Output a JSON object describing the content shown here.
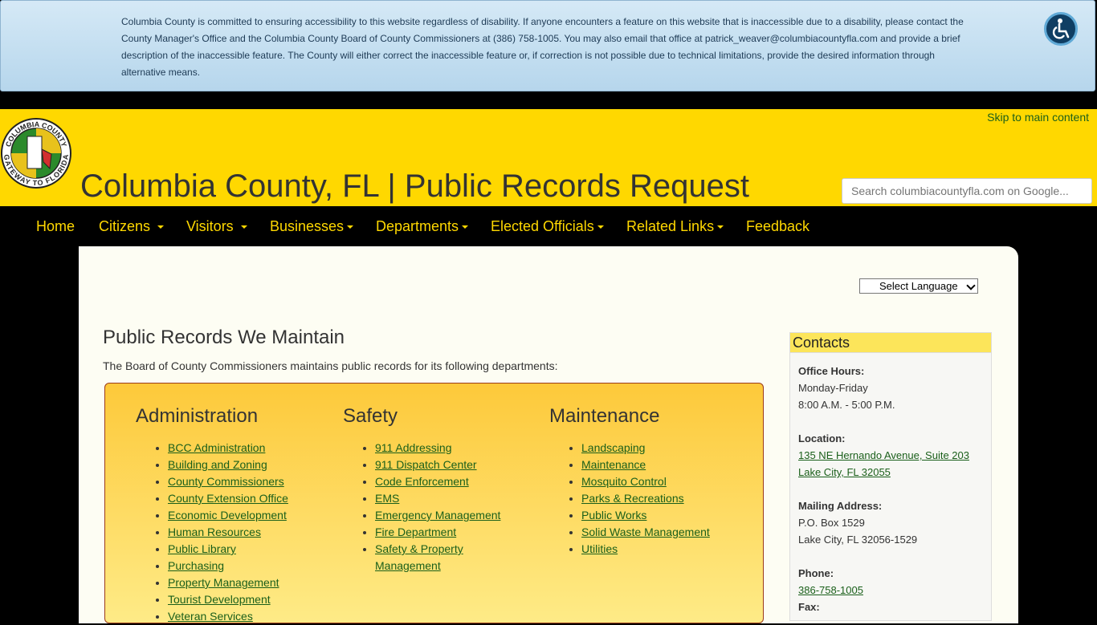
{
  "accessibility": {
    "notice": "Columbia County is committed to ensuring accessibility to this website regardless of disability. If anyone encounters a feature on this website that is inaccessible due to a disability, please contact the County Manager's Office and the Columbia County Board of County Commissioners at (386) 758-1005. You may also email that office at patrick_weaver@columbiacountyfla.com and provide a brief description of the inaccessible feature. The County will either correct the inaccessible feature or, if correction is not possible due to technical limitations, provide the desired information through alternative means."
  },
  "header": {
    "title": "Columbia County, FL | Public Records Request",
    "skip_link": "Skip to main content",
    "search_placeholder": "Search columbiacountyfla.com on Google...",
    "logo_top_text": "COLUMBIA COUNTY",
    "logo_bottom_text": "GATEWAY TO FLORIDA"
  },
  "nav": {
    "home": "Home",
    "citizens": "Citizens",
    "visitors": "Visitors",
    "businesses": "Businesses",
    "departments": "Departments",
    "elected": "Elected Officials",
    "related": "Related Links",
    "feedback": "Feedback"
  },
  "language": {
    "label": "Select Language"
  },
  "main": {
    "heading": "Public Records We Maintain",
    "intro": "The Board of County Commissioners maintains public records for its following departments:",
    "columns": [
      {
        "title": "Administration",
        "items": [
          "BCC Administration",
          "Building and Zoning",
          "County Commissioners",
          "County Extension Office",
          "Economic Development",
          "Human Resources",
          "Public Library",
          "Purchasing",
          "Property Management",
          "Tourist Development",
          "Veteran Services"
        ]
      },
      {
        "title": "Safety",
        "items": [
          "911 Addressing",
          "911 Dispatch Center",
          "Code Enforcement",
          "EMS",
          "Emergency Management",
          "Fire Department",
          "Safety & Property Management"
        ]
      },
      {
        "title": "Maintenance",
        "items": [
          "Landscaping",
          "Maintenance",
          "Mosquito Control",
          "Parks & Recreations",
          "Public Works",
          "Solid Waste Management",
          "Utilities"
        ]
      }
    ]
  },
  "contacts": {
    "title": "Contacts",
    "hours_label": "Office Hours:",
    "hours_days": "Monday-Friday",
    "hours_time": "8:00 A.M. - 5:00 P.M.",
    "location_label": "Location:",
    "location_line1": "135 NE Hernando Avenue, Suite 203",
    "location_line2": "Lake City, FL 32055",
    "mailing_label": "Mailing Address:",
    "mailing_line1": "P.O. Box 1529",
    "mailing_line2": "Lake City, FL 32056-1529",
    "phone_label": "Phone:",
    "phone": "386-758-1005",
    "fax_label": "Fax:"
  },
  "colors": {
    "header_yellow": "#ffd800",
    "nav_text": "#ffd800",
    "link_green": "#1a5f1a"
  }
}
